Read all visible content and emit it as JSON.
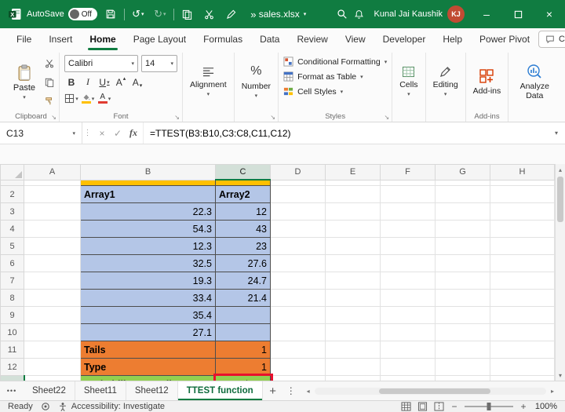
{
  "colors": {
    "titlebar_green": "#107C41",
    "cell_blue": "#B4C6E7",
    "cell_orange": "#ED7D31",
    "cell_green": "#92D050",
    "cell_gold": "#FFC000",
    "annotation_red": "#E8112D",
    "avatar_orange": "#C14B33"
  },
  "titlebar": {
    "autosave_label": "AutoSave",
    "autosave_state": "Off",
    "filename": "sales.xlsx",
    "user_name": "Kunal Jai Kaushik",
    "user_initials": "KJ"
  },
  "ribbon_tabs": [
    {
      "label": "File"
    },
    {
      "label": "Insert"
    },
    {
      "label": "Home",
      "active": true
    },
    {
      "label": "Page Layout"
    },
    {
      "label": "Formulas"
    },
    {
      "label": "Data"
    },
    {
      "label": "Review"
    },
    {
      "label": "View"
    },
    {
      "label": "Developer"
    },
    {
      "label": "Help"
    },
    {
      "label": "Power Pivot"
    }
  ],
  "ribbon_right": {
    "comments": "Comments"
  },
  "ribbon": {
    "clipboard": {
      "group_label": "Clipboard",
      "paste_label": "Paste"
    },
    "font": {
      "group_label": "Font",
      "font_name": "Calibri",
      "font_size": "14",
      "bold": "B",
      "italic": "I",
      "underline": "U"
    },
    "alignment": {
      "label": "Alignment"
    },
    "number": {
      "label": "Number"
    },
    "styles": {
      "group_label": "Styles",
      "conditional": "Conditional Formatting",
      "format_table": "Format as Table",
      "cell_styles": "Cell Styles"
    },
    "cells": {
      "label": "Cells"
    },
    "editing": {
      "label": "Editing"
    },
    "addins": {
      "label": "Add-ins",
      "group_label": "Add-ins"
    },
    "analyze": {
      "label": "Analyze Data"
    }
  },
  "formula_bar": {
    "name_box": "C13",
    "fx_label": "fx",
    "formula": "=TTEST(B3:B10,C3:C8,C11,C12)"
  },
  "grid": {
    "col_headers": [
      "A",
      "B",
      "C",
      "D",
      "E",
      "F",
      "G",
      "H"
    ],
    "selected_col": "C",
    "selected_row": "13",
    "partial_row": {
      "fill": "gold",
      "cols": [
        "B",
        "C"
      ]
    },
    "rows": [
      {
        "num": "2",
        "b": "Array1",
        "c": "Array2",
        "fill": "blue",
        "b_align": "left",
        "c_align": "left",
        "b_bold": true,
        "c_bold": true
      },
      {
        "num": "3",
        "b": "22.3",
        "c": "12",
        "fill": "blue",
        "b_align": "right",
        "c_align": "right"
      },
      {
        "num": "4",
        "b": "54.3",
        "c": "43",
        "fill": "blue",
        "b_align": "right",
        "c_align": "right"
      },
      {
        "num": "5",
        "b": "12.3",
        "c": "23",
        "fill": "blue",
        "b_align": "right",
        "c_align": "right"
      },
      {
        "num": "6",
        "b": "32.5",
        "c": "27.6",
        "fill": "blue",
        "b_align": "right",
        "c_align": "right"
      },
      {
        "num": "7",
        "b": "19.3",
        "c": "24.7",
        "fill": "blue",
        "b_align": "right",
        "c_align": "right"
      },
      {
        "num": "8",
        "b": "33.4",
        "c": "21.4",
        "fill": "blue",
        "b_align": "right",
        "c_align": "right"
      },
      {
        "num": "9",
        "b": "35.4",
        "c": "",
        "fill": "blue",
        "b_align": "right",
        "c_align": "right"
      },
      {
        "num": "10",
        "b": "27.1",
        "c": "",
        "fill": "blue",
        "b_align": "right",
        "c_align": "right"
      },
      {
        "num": "11",
        "b": "Tails",
        "c": "1",
        "fill": "orange",
        "b_align": "left",
        "c_align": "right",
        "b_bold": true
      },
      {
        "num": "12",
        "b": "Type",
        "c": "1",
        "fill": "orange",
        "b_align": "left",
        "c_align": "right",
        "b_bold": true
      },
      {
        "num": "13",
        "b": "Probability one tail",
        "c": "#N/A",
        "fill": "green",
        "b_align": "left",
        "c_align": "center",
        "b_bold": true,
        "warning": true,
        "selected": true
      }
    ]
  },
  "sheet_tabs": {
    "overflow": "•••",
    "add_label": "+",
    "tabs": [
      {
        "label": "Sheet22"
      },
      {
        "label": "Sheet11"
      },
      {
        "label": "Sheet12"
      },
      {
        "label": "TTEST function",
        "active": true
      }
    ]
  },
  "status_bar": {
    "mode": "Ready",
    "accessibility": "Accessibility: Investigate",
    "zoom": "100%"
  }
}
